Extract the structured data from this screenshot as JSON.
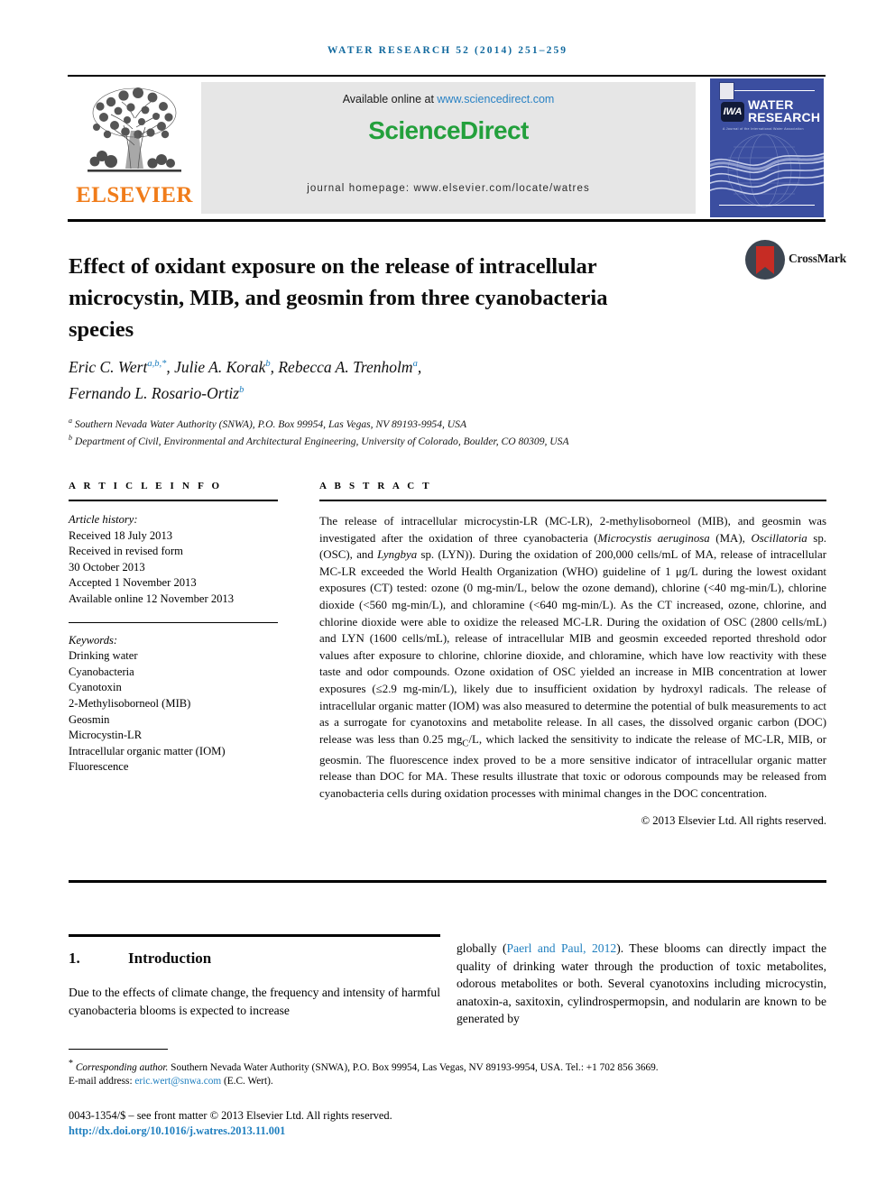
{
  "running_head": "WATER RESEARCH 52 (2014) 251–259",
  "masthead": {
    "publisher_name": "ELSEVIER",
    "available_prefix": "Available online at ",
    "available_url": "www.sciencedirect.com",
    "sciencedirect_logo": "ScienceDirect",
    "journal_homepage": "journal homepage: www.elsevier.com/locate/watres",
    "cover": {
      "title_line1": "WATER",
      "title_line2": "RESEARCH",
      "iwa_mark": "IWA",
      "subtitle": "A Journal of the International Water Association"
    }
  },
  "article": {
    "title": "Effect of oxidant exposure on the release of intracellular microcystin, MIB, and geosmin from three cyanobacteria species",
    "crossmark_label": "CrossMark",
    "authors_line1_pre": "Eric C. Wert",
    "authors_line1": "Eric C. Wert a,b,*, Julie A. Korak b, Rebecca A. Trenholm a,",
    "authors_line2": "Fernando L. Rosario-Ortiz b",
    "affiliation_a": "Southern Nevada Water Authority (SNWA), P.O. Box 99954, Las Vegas, NV 89193-9954, USA",
    "affiliation_b": "Department of Civil, Environmental and Architectural Engineering, University of Colorado, Boulder, CO 80309, USA"
  },
  "article_info": {
    "heading": "A R T I C L E   I N F O",
    "history_label": "Article history:",
    "history": [
      "Received 18 July 2013",
      "Received in revised form",
      "30 October 2013",
      "Accepted 1 November 2013",
      "Available online 12 November 2013"
    ],
    "keywords_label": "Keywords:",
    "keywords": [
      "Drinking water",
      "Cyanobacteria",
      "Cyanotoxin",
      "2-Methylisoborneol (MIB)",
      "Geosmin",
      "Microcystin-LR",
      "Intracellular organic matter (IOM)",
      "Fluorescence"
    ]
  },
  "abstract": {
    "heading": "A B S T R A C T",
    "text_part1": "The release of intracellular microcystin-LR (MC-LR), 2-methylisoborneol (MIB), and geosmin was investigated after the oxidation of three cyanobacteria (",
    "species1": "Microcystis aeruginosa",
    "text_part2": " (MA), ",
    "species2": "Oscillatoria",
    "text_part3": " sp. (OSC), and ",
    "species3": "Lyngbya",
    "text_part4": " sp. (LYN)). During the oxidation of 200,000 cells/mL of MA, release of intracellular MC-LR exceeded the World Health Organization (WHO) guideline of 1 μg/L during the lowest oxidant exposures (CT) tested: ozone (0 mg-min/L, below the ozone demand), chlorine (<40 mg-min/L), chlorine dioxide (<560 mg-min/L), and chloramine (<640 mg-min/L). As the CT increased, ozone, chlorine, and chlorine dioxide were able to oxidize the released MC-LR. During the oxidation of OSC (2800 cells/mL) and LYN (1600 cells/mL), release of intracellular MIB and geosmin exceeded reported threshold odor values after exposure to chlorine, chlorine dioxide, and chloramine, which have low reactivity with these taste and odor compounds. Ozone oxidation of OSC yielded an increase in MIB concentration at lower exposures (≤2.9 mg-min/L), likely due to insufficient oxidation by hydroxyl radicals. The release of intracellular organic matter (IOM) was also measured to determine the potential of bulk measurements to act as a surrogate for cyanotoxins and metabolite release. In all cases, the dissolved organic carbon (DOC) release was less than 0.25 mg",
    "sub_c": "C",
    "text_part5": "/L, which lacked the sensitivity to indicate the release of MC-LR, MIB, or geosmin. The fluorescence index proved to be a more sensitive indicator of intracellular organic matter release than DOC for MA. These results illustrate that toxic or odorous compounds may be released from cyanobacteria cells during oxidation processes with minimal changes in the DOC concentration.",
    "copyright": "© 2013 Elsevier Ltd. All rights reserved."
  },
  "body": {
    "section_number": "1.",
    "section_title": "Introduction",
    "left_paragraph": "Due to the effects of climate change, the frequency and intensity of harmful cyanobacteria blooms is expected to increase",
    "right_pre": "globally (",
    "right_citation": "Paerl and Paul, 2012",
    "right_post": "). These blooms can directly impact the quality of drinking water through the production of toxic metabolites, odorous metabolites or both. Several cyanotoxins including microcystin, anatoxin-a, saxitoxin, cylindrospermopsin, and nodularin are known to be generated by"
  },
  "footer": {
    "corresponding_marker": "*",
    "corresponding_label": "Corresponding author.",
    "corresponding_text": " Southern Nevada Water Authority (SNWA), P.O. Box 99954, Las Vegas, NV 89193-9954, USA. Tel.: +1 702 856 3669.",
    "email_label": "E-mail address: ",
    "email": "eric.wert@snwa.com",
    "email_suffix": " (E.C. Wert).",
    "front_matter": "0043-1354/$ – see front matter © 2013 Elsevier Ltd. All rights reserved.",
    "doi": "http://dx.doi.org/10.1016/j.watres.2013.11.001"
  }
}
